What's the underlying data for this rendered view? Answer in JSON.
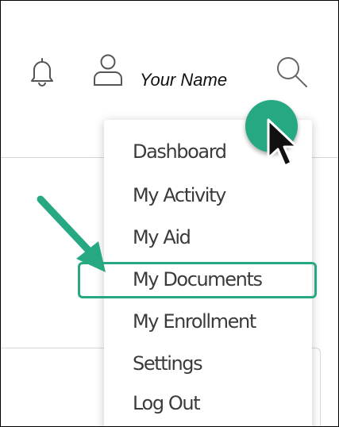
{
  "header": {
    "user_name": "Your Name",
    "icons": [
      "bell-icon",
      "user-icon",
      "search-icon"
    ]
  },
  "menu": {
    "items": [
      {
        "label": "Dashboard"
      },
      {
        "label": "My Activity"
      },
      {
        "label": "My Aid"
      },
      {
        "label": "My Documents",
        "highlighted": true
      },
      {
        "label": "My Enrollment"
      },
      {
        "label": "Settings"
      },
      {
        "label": "Log Out"
      }
    ]
  },
  "annotation": {
    "accent_color": "#26a883",
    "cursor": "arrow-cursor-icon"
  }
}
